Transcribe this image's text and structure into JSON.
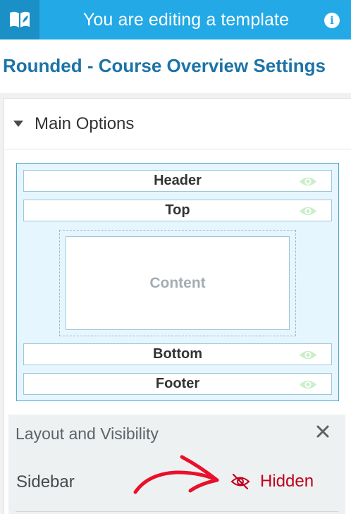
{
  "topbar": {
    "title": "You are editing a template",
    "logo_icon": "book-icon",
    "info_icon": "info-icon",
    "color": "#22a9e6"
  },
  "page": {
    "title": "Rounded - Course Overview Settings"
  },
  "main_options": {
    "title": "Main Options",
    "regions": [
      {
        "label": "Header",
        "visible": true
      },
      {
        "label": "Top",
        "visible": true
      },
      {
        "label": "Bottom",
        "visible": true
      },
      {
        "label": "Footer",
        "visible": true
      }
    ],
    "content_label": "Content"
  },
  "layout_visibility": {
    "title": "Layout and Visibility",
    "close_icon": "close-icon",
    "rows": [
      {
        "label": "Sidebar",
        "state": "Hidden",
        "state_color": "#c0001b"
      }
    ]
  }
}
